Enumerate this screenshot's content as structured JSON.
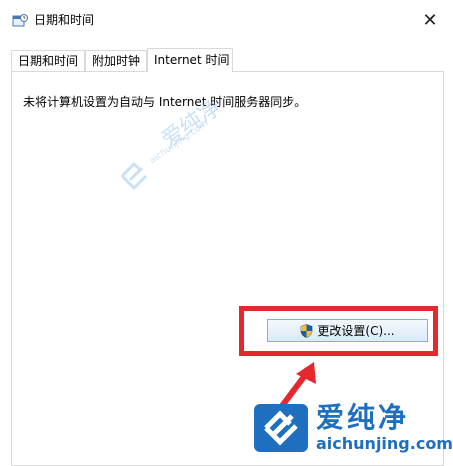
{
  "window": {
    "title": "日期和时间",
    "close_symbol": "✕"
  },
  "tabs": [
    {
      "label": "日期和时间",
      "selected": false
    },
    {
      "label": "附加时钟",
      "selected": false
    },
    {
      "label": "Internet 时间",
      "selected": true
    }
  ],
  "panel": {
    "status_text": "未将计算机设置为自动与 Internet 时间服务器同步。",
    "change_settings_label": "更改设置(C)..."
  },
  "watermark": {
    "brand_cn": "爱纯净",
    "brand_url": "aichunjing.com"
  },
  "colors": {
    "highlight": "#e5282d",
    "brand_blue": "#1e6fc0"
  },
  "icons": {
    "title": "clock-calendar-icon",
    "button": "uac-shield-icon",
    "close": "close-icon"
  }
}
